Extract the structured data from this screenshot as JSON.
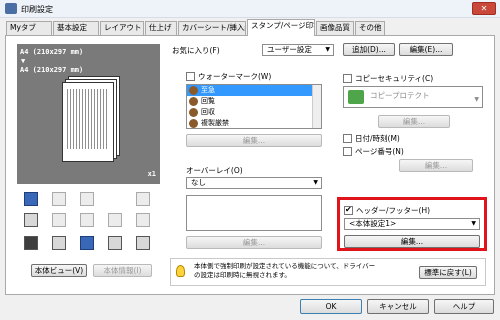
{
  "window": {
    "title": "印刷設定",
    "close_glyph": "✕"
  },
  "tabs": [
    {
      "label": "Myタブ"
    },
    {
      "label": "基本設定"
    },
    {
      "label": "レイアウト"
    },
    {
      "label": "仕上げ"
    },
    {
      "label": "カバーシート/挿入紙"
    },
    {
      "label": "スタンプ/ページ印字",
      "active": true
    },
    {
      "label": "画像品質"
    },
    {
      "label": "その他"
    }
  ],
  "preview": {
    "paper_top": "A4 (210x297 mm)",
    "arrow": "▼",
    "paper_bottom": "A4 (210x297 mm)",
    "copies": "x1"
  },
  "left_buttons": {
    "body_view": "本体ビュー(V)",
    "body_info": "本体情報(I)"
  },
  "favorites": {
    "label": "お気に入り(F)",
    "value": "ユーザー設定",
    "add": "追加(D)...",
    "edit": "編集(E)..."
  },
  "watermark": {
    "label": "ウォーターマーク(W)",
    "items": [
      "至急",
      "回覧",
      "回収",
      "複製厳禁"
    ],
    "edit": "編集..."
  },
  "overlay": {
    "label": "オーバーレイ(O)",
    "value": "なし",
    "edit": "編集..."
  },
  "copy_security": {
    "label": "コピーセキュリティ(C)",
    "value": "コピープロテクト",
    "edit": "編集..."
  },
  "date_time": {
    "label": "日付/時刻(M)"
  },
  "page_number": {
    "label": "ページ番号(N)",
    "edit": "編集..."
  },
  "header_footer": {
    "label": "ヘッダー/フッター(H)",
    "value": "<本体設定1>",
    "edit": "編集..."
  },
  "info": {
    "text": "本体側で強制印刷が設定されている機能について、ドライバーの設定は印刷時に無視されます。",
    "reset": "標準に戻す(L)"
  },
  "footer": {
    "ok": "OK",
    "cancel": "キャンセル",
    "help": "ヘルプ"
  },
  "colors": {
    "highlight_box": "#e2141b",
    "list_selection": "#3399ff",
    "title_close": "#c9483a"
  }
}
